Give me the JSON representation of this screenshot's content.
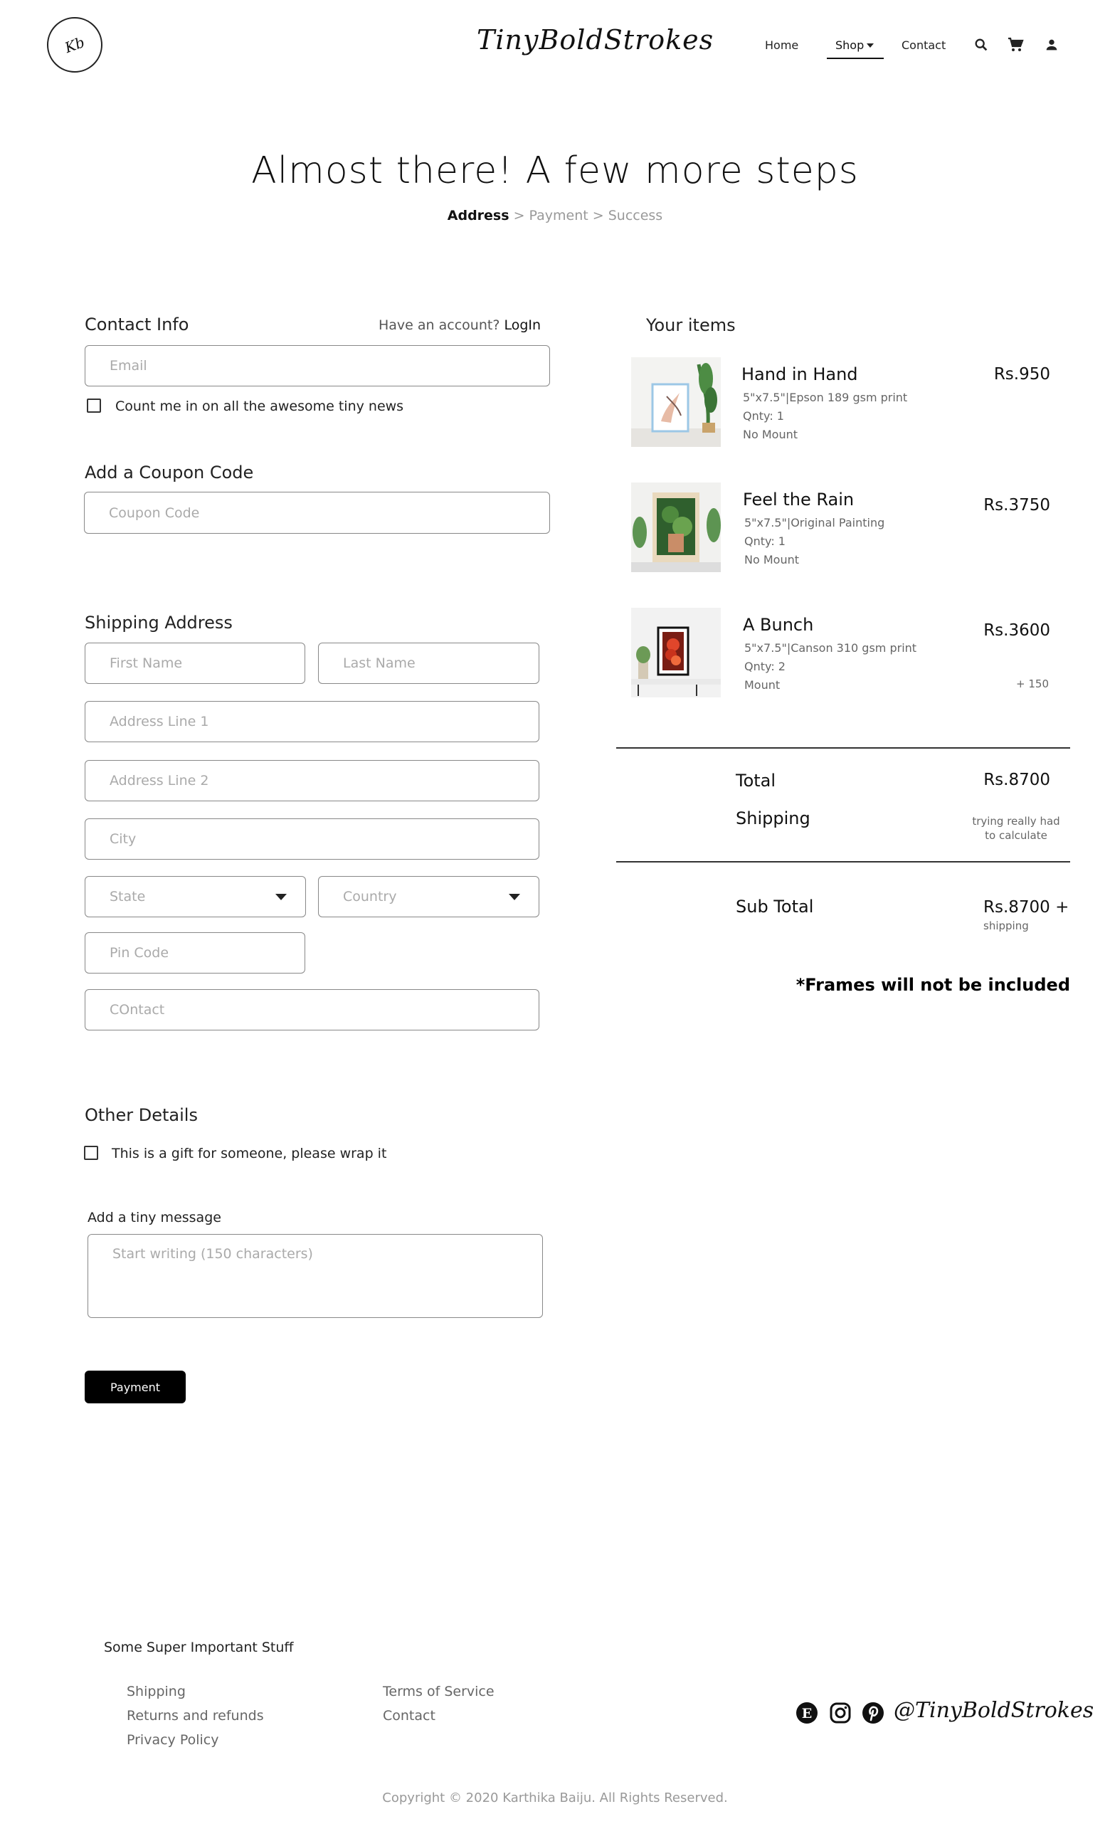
{
  "header": {
    "logo_text": "Kb",
    "brand": "TinyBoldStrokes",
    "nav": {
      "home": "Home",
      "shop": "Shop",
      "contact": "Contact"
    }
  },
  "heading": {
    "title": "Almost there! A few more steps",
    "steps": {
      "current": "Address",
      "rest": " > Payment > Success"
    }
  },
  "contact": {
    "title": "Contact Info",
    "have_account": "Have an account?",
    "login": "LogIn",
    "email_placeholder": "Email",
    "newsletter_label": "Count me in on all the awesome tiny news"
  },
  "coupon": {
    "title": "Add a Coupon Code",
    "placeholder": "Coupon Code"
  },
  "shipping": {
    "title": "Shipping Address",
    "first_name": "First Name",
    "last_name": "Last Name",
    "address1": "Address Line 1",
    "address2": "Address Line 2",
    "city": "City",
    "state": "State",
    "country": "Country",
    "pin": "Pin Code",
    "contact": "COntact"
  },
  "other": {
    "title": "Other Details",
    "gift_label": "This is a gift for someone, please wrap it",
    "message_label": "Add a tiny message",
    "message_placeholder": "Start writing (150 characters)"
  },
  "payment_button": "Payment",
  "items": {
    "title": "Your items",
    "list": [
      {
        "name": "Hand in Hand",
        "spec": "5\"x7.5\"|Epson 189 gsm print",
        "qty": "Qnty: 1",
        "mount": "No Mount",
        "price": "Rs.950",
        "extra": ""
      },
      {
        "name": "Feel the Rain",
        "spec": "5\"x7.5\"|Original Painting",
        "qty": "Qnty: 1",
        "mount": "No Mount",
        "price": "Rs.3750",
        "extra": ""
      },
      {
        "name": "A Bunch",
        "spec": "5\"x7.5\"|Canson 310 gsm print",
        "qty": "Qnty: 2",
        "mount": "Mount",
        "price": "Rs.3600",
        "extra": "+ 150"
      }
    ]
  },
  "summary": {
    "total_label": "Total",
    "total_value": "Rs.8700",
    "shipping_label": "Shipping",
    "shipping_note_1": "trying really had",
    "shipping_note_2": "to calculate",
    "subtotal_label": "Sub Total",
    "subtotal_value": "Rs.8700 +",
    "subtotal_note": "shipping",
    "frames_note": "*Frames will not be included"
  },
  "footer": {
    "title": "Some Super Important Stuff",
    "links_left": [
      "Shipping",
      "Returns and refunds",
      "Privacy Policy"
    ],
    "links_right": [
      "Terms of Service",
      "Contact"
    ],
    "handle": "@TinyBoldStrokes",
    "etsy_letter": "E",
    "copyright": "Copyright © 2020 Karthika Baiju. All Rights Reserved."
  },
  "icons": [
    "search-icon",
    "cart-icon",
    "account-icon",
    "etsy-icon",
    "instagram-icon",
    "pinterest-icon",
    "caret-down-icon"
  ]
}
